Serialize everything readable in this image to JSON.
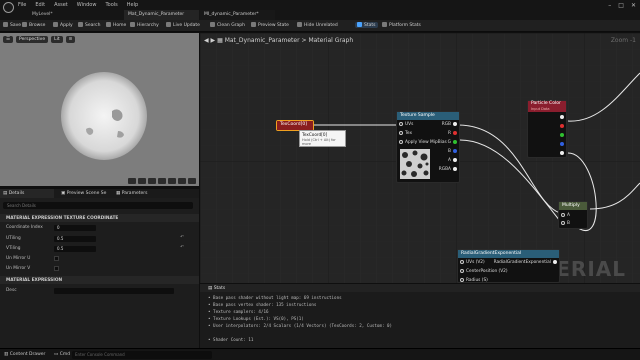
{
  "titlebar": {
    "menu": [
      "File",
      "Edit",
      "Asset",
      "Window",
      "Tools",
      "Help"
    ],
    "level": "MyLevel*",
    "tabs": [
      "Mat_Dynamic_Parameter",
      "MI_dynamic_Parameter*"
    ]
  },
  "toolbar": {
    "save": "Save",
    "browse": "Browse",
    "apply": "Apply",
    "search": "Search",
    "home": "Home",
    "hierarchy": "Hierarchy",
    "live_update": "Live Update",
    "clean_graph": "Clean Graph",
    "preview_state": "Preview State",
    "hide_unrelated": "Hide Unrelated",
    "stats": "Stats",
    "platform_stats": "Platform Stats"
  },
  "viewport": {
    "perspective": "Perspective",
    "lit": "Lit"
  },
  "lower_tabs": {
    "details": "Details",
    "preview_scene": "Preview Scene Se",
    "parameters": "Parameters"
  },
  "details": {
    "search_placeholder": "Search Details",
    "section_texcoord": "MATERIAL EXPRESSION TEXTURE COORDINATE",
    "coordinate_index_label": "Coordinate Index",
    "coordinate_index_value": "0",
    "utiling_label": "UTiling",
    "utiling_value": "0.5",
    "vtiling_label": "VTiling",
    "vtiling_value": "0.5",
    "un_mirror_u_label": "Un Mirror U",
    "un_mirror_v_label": "Un Mirror V",
    "section_expression": "MATERIAL EXPRESSION",
    "desc_label": "Desc"
  },
  "graph": {
    "breadcrumb_asset": "Mat_Dynamic_Parameter",
    "breadcrumb_sep": ">",
    "breadcrumb_graph": "Material Graph",
    "zoom": "Zoom -1",
    "watermark": "MATERIAL",
    "texcoord_node": "TexCoord[0]",
    "tooltip_title": "TexCoord[0]",
    "tooltip_hint": "Hold (Ctrl + Alt) for more",
    "texture_sample": {
      "title": "Texture Sample",
      "pins_in": [
        "UVs",
        "Tex",
        "Apply View MipBias"
      ],
      "pins_out": [
        "RGB",
        "R",
        "G",
        "B",
        "A",
        "RGBA"
      ]
    },
    "particle_color": {
      "title": "Particle Color",
      "subtitle": "Input Data"
    },
    "multiply": {
      "title": "Multiply",
      "pins": [
        "A",
        "B"
      ]
    },
    "radial": {
      "title": "RadialGradientExponential",
      "pins_in": [
        "UVs (V2)",
        "CenterPosition (V2)",
        "Radius (S)"
      ],
      "out": "RadialGradientExponential"
    }
  },
  "stats": {
    "title": "Stats",
    "lines": [
      "Base pass shader without light map: 69 instructions",
      "Base pass vertex shader: 135 instructions",
      "Texture samplers: 4/16",
      "Texture Lookups (Est.): VS(0), PS(1)",
      "User interpolators: 2/4 Scalars (1/4 Vectors) (TexCoords: 2, Custom: 0)",
      "",
      "Shader Count: 11"
    ]
  },
  "statusbar": {
    "content_drawer": "Content Drawer",
    "cmd": "Cmd",
    "console_placeholder": "Enter Console Command"
  }
}
